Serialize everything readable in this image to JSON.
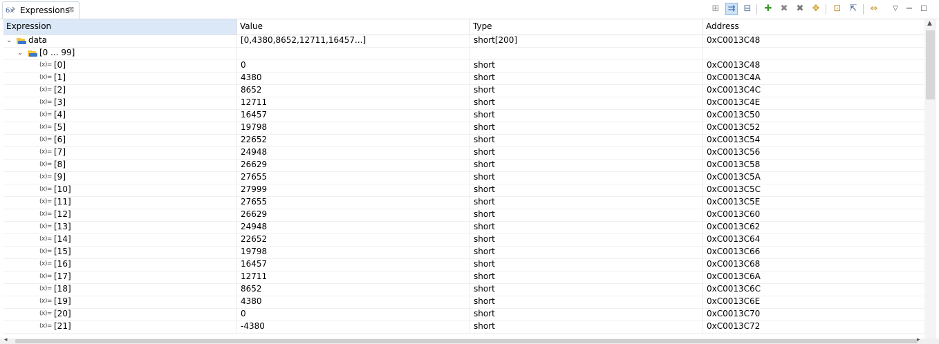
{
  "tab": {
    "label": "Expressions",
    "close": "⊠"
  },
  "columns": [
    "Expression",
    "Value",
    "Type",
    "Address"
  ],
  "rows": [
    {
      "expr": "data",
      "value": "[0,4380,8652,12711,16457...]",
      "type": "short[200]",
      "address": "0xC0013C48"
    },
    {
      "expr": "[0 ... 99]",
      "value": "",
      "type": "",
      "address": ""
    },
    {
      "expr": "[0]",
      "value": "0",
      "type": "short",
      "address": "0xC0013C48"
    },
    {
      "expr": "[1]",
      "value": "4380",
      "type": "short",
      "address": "0xC0013C4A"
    },
    {
      "expr": "[2]",
      "value": "8652",
      "type": "short",
      "address": "0xC0013C4C"
    },
    {
      "expr": "[3]",
      "value": "12711",
      "type": "short",
      "address": "0xC0013C4E"
    },
    {
      "expr": "[4]",
      "value": "16457",
      "type": "short",
      "address": "0xC0013C50"
    },
    {
      "expr": "[5]",
      "value": "19798",
      "type": "short",
      "address": "0xC0013C52"
    },
    {
      "expr": "[6]",
      "value": "22652",
      "type": "short",
      "address": "0xC0013C54"
    },
    {
      "expr": "[7]",
      "value": "24948",
      "type": "short",
      "address": "0xC0013C56"
    },
    {
      "expr": "[8]",
      "value": "26629",
      "type": "short",
      "address": "0xC0013C58"
    },
    {
      "expr": "[9]",
      "value": "27655",
      "type": "short",
      "address": "0xC0013C5A"
    },
    {
      "expr": "[10]",
      "value": "27999",
      "type": "short",
      "address": "0xC0013C5C"
    },
    {
      "expr": "[11]",
      "value": "27655",
      "type": "short",
      "address": "0xC0013C5E"
    },
    {
      "expr": "[12]",
      "value": "26629",
      "type": "short",
      "address": "0xC0013C60"
    },
    {
      "expr": "[13]",
      "value": "24948",
      "type": "short",
      "address": "0xC0013C62"
    },
    {
      "expr": "[14]",
      "value": "22652",
      "type": "short",
      "address": "0xC0013C64"
    },
    {
      "expr": "[15]",
      "value": "19798",
      "type": "short",
      "address": "0xC0013C66"
    },
    {
      "expr": "[16]",
      "value": "16457",
      "type": "short",
      "address": "0xC0013C68"
    },
    {
      "expr": "[17]",
      "value": "12711",
      "type": "short",
      "address": "0xC0013C6A"
    },
    {
      "expr": "[18]",
      "value": "8652",
      "type": "short",
      "address": "0xC0013C6C"
    },
    {
      "expr": "[19]",
      "value": "4380",
      "type": "short",
      "address": "0xC0013C6E"
    },
    {
      "expr": "[20]",
      "value": "0",
      "type": "short",
      "address": "0xC0013C70"
    },
    {
      "expr": "[21]",
      "value": "-4380",
      "type": "short",
      "address": "0xC0013C72"
    }
  ],
  "icons": {
    "tab": "expressions-view-icon",
    "variable": "variable-icon",
    "variable_glyph": "(x)=",
    "expand": "⌄",
    "toolbar": [
      "show-type-names",
      "show-logical-structure",
      "collapse-all",
      "add-expression",
      "remove-expression",
      "remove-all-expressions",
      "reevaluate",
      "new-watch",
      "export",
      "link-with-editor",
      "view-menu",
      "minimize",
      "maximize"
    ]
  },
  "colors": {
    "header_selected": "#dae8f7",
    "folder_yellow": "#f4c542",
    "folder_blue": "#3a78c9"
  }
}
